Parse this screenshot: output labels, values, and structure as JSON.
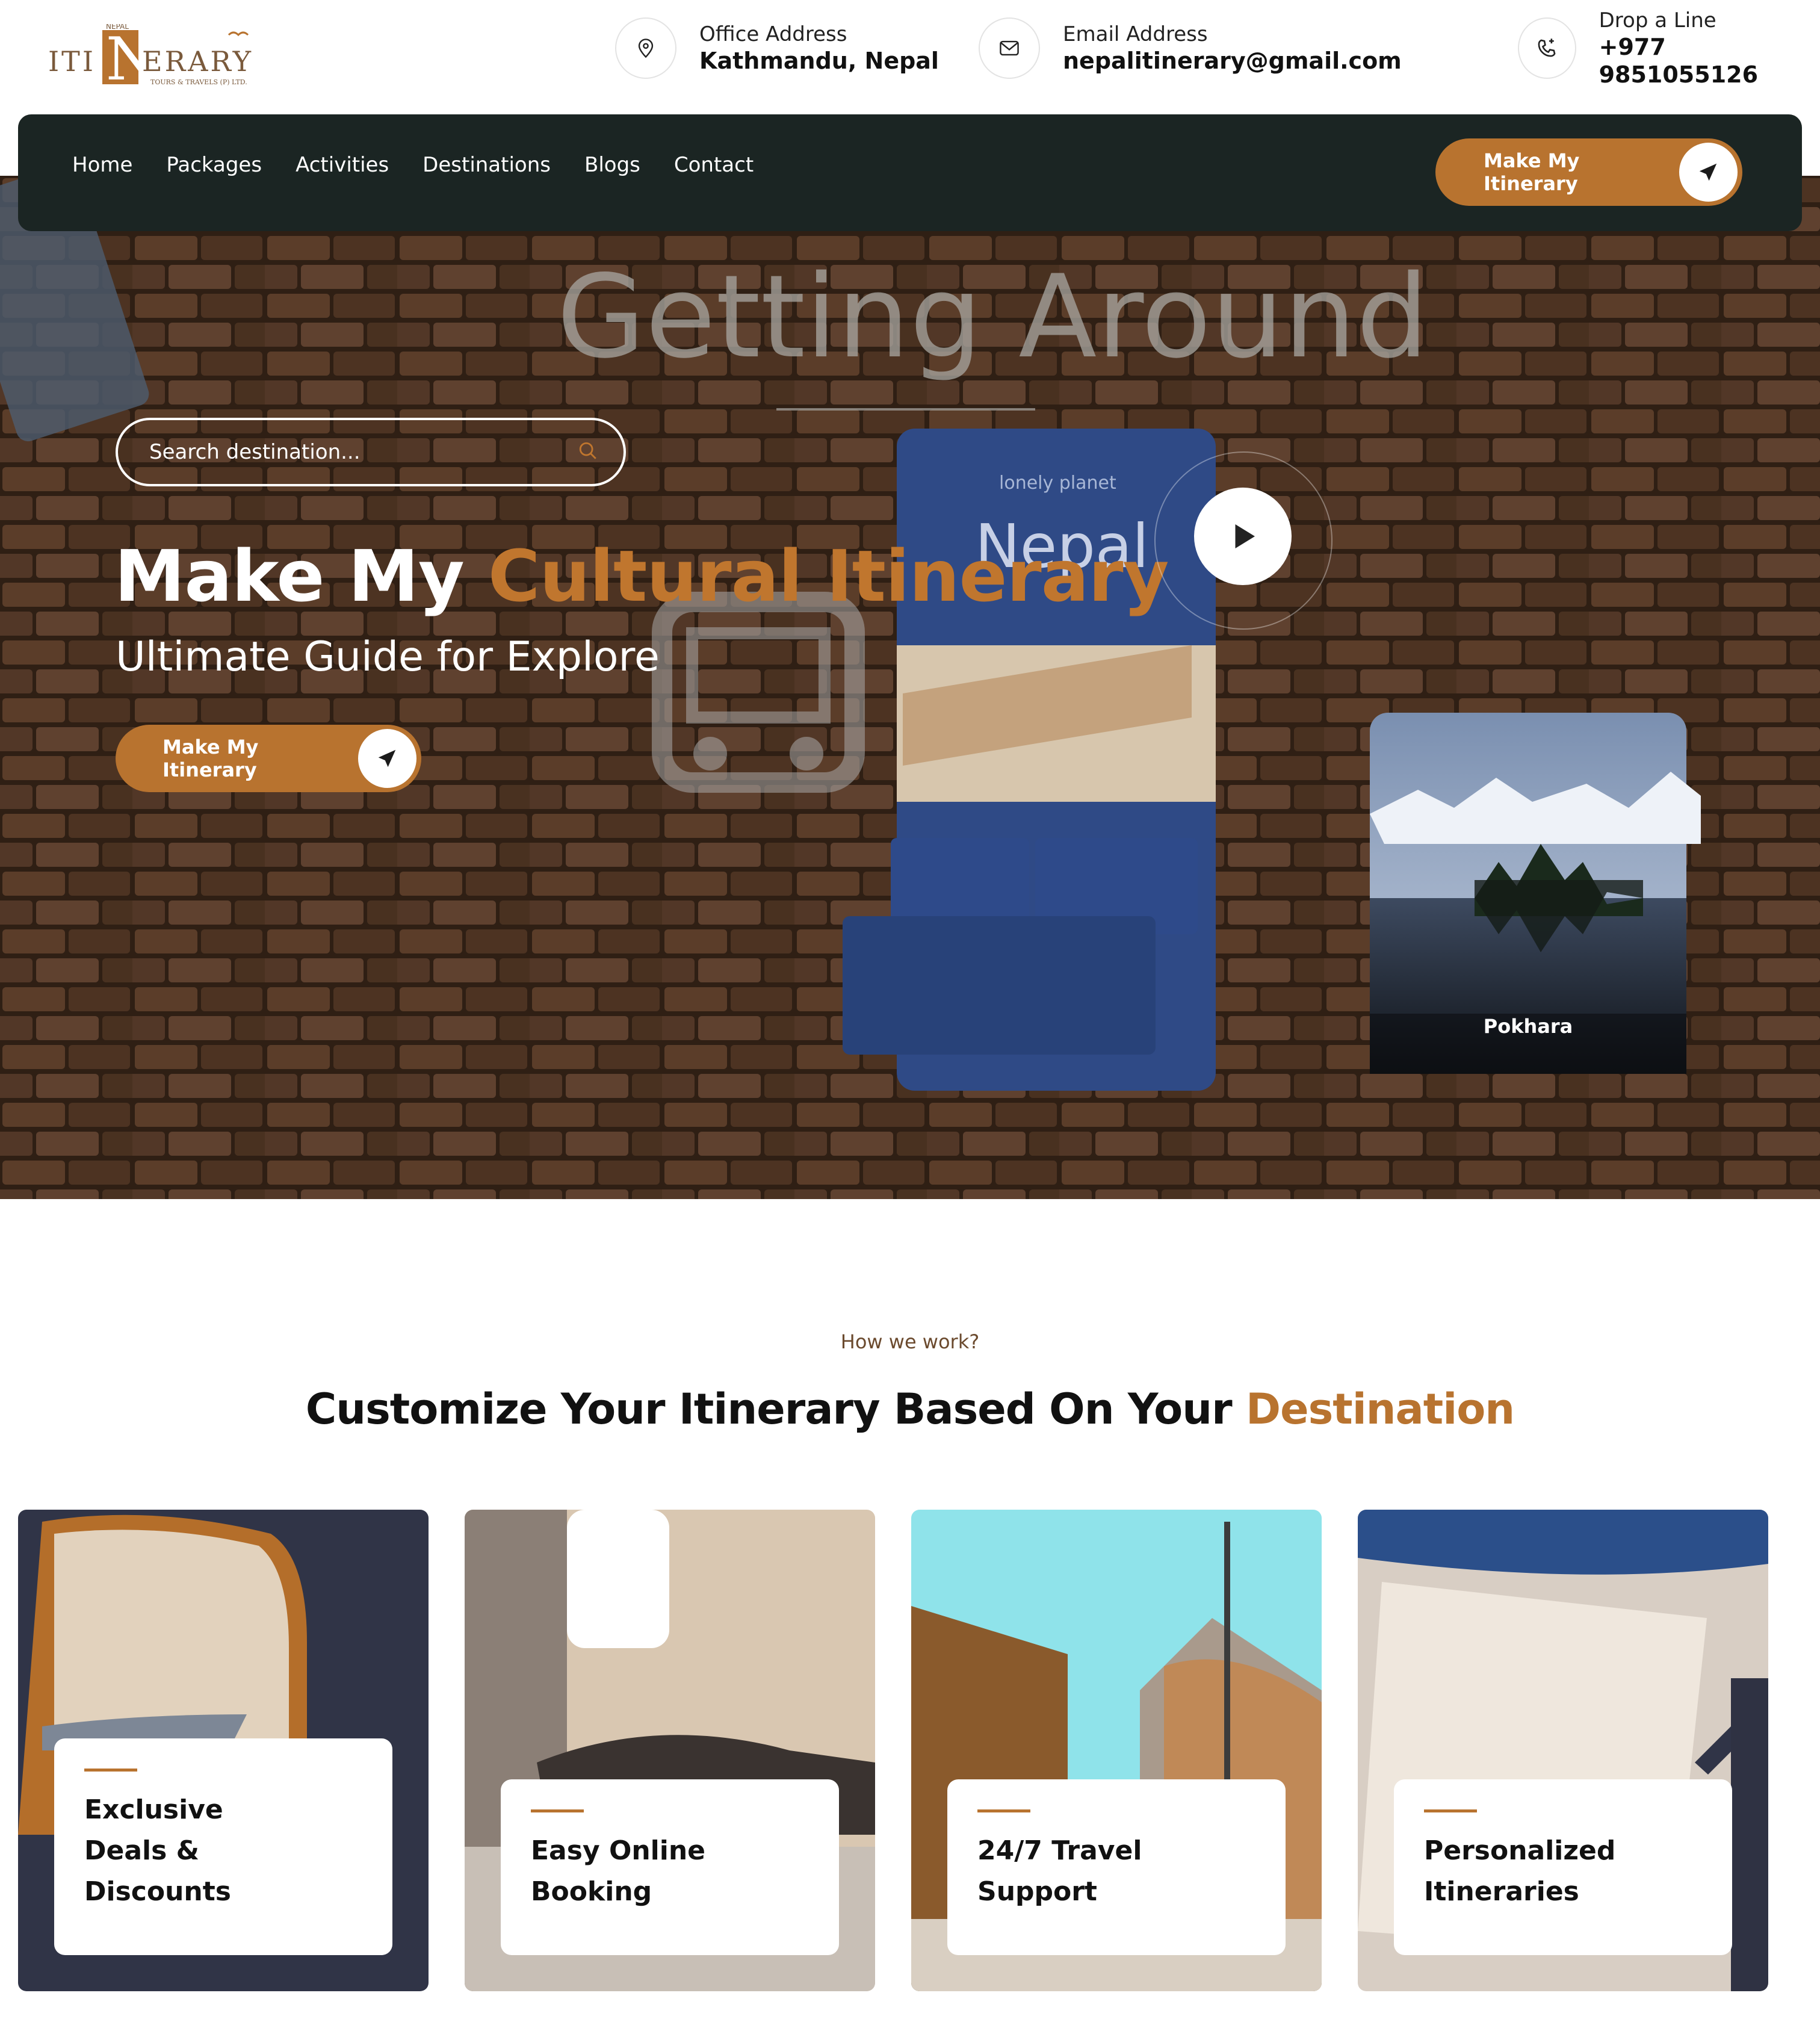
{
  "brand": {
    "logo_top": "NEPAL",
    "logo_main": "ITINERARY",
    "logo_sub": "TOURS & TRAVELS (P) LTD."
  },
  "contacts": [
    {
      "label": "Office Address",
      "value": "Kathmandu, Nepal",
      "icon": "location-pin-icon"
    },
    {
      "label": "Email Address",
      "value": "nepalitinerary@gmail.com",
      "icon": "mail-icon"
    },
    {
      "label": "Drop a Line",
      "value": "+977 9851055126",
      "icon": "phone-icon"
    }
  ],
  "nav": {
    "items": [
      "Home",
      "Packages",
      "Activities",
      "Destinations",
      "Blogs",
      "Contact"
    ],
    "cta": "Make My Itinerary"
  },
  "hero": {
    "bg_text": "Getting Around",
    "guide_word": "Nepal",
    "guide_brand": "lonely planet",
    "search_placeholder": "Search destination...",
    "title_plain": "Make My",
    "title_accent": "Cultural Itinerary",
    "subtitle": "Ultimate Guide for Explore",
    "cta": "Make My Itinerary",
    "card_caption": "Pokhara"
  },
  "how": {
    "eyebrow": "How we work?",
    "title_plain": "Customize Your Itinerary Based On Your",
    "title_accent": "Destination",
    "cards": [
      {
        "line1": "Exclusive",
        "line2": "Deals &",
        "line3": "Discounts"
      },
      {
        "line1": "Easy Online",
        "line2": "Booking"
      },
      {
        "line1": "24/7 Travel",
        "line2": "Support"
      },
      {
        "line1": "Personalized",
        "line2": "Itineraries"
      }
    ]
  },
  "colors": {
    "accent": "#b8732f",
    "nav_bg": "#1b2523",
    "eyebrow": "#6b4a2e"
  }
}
